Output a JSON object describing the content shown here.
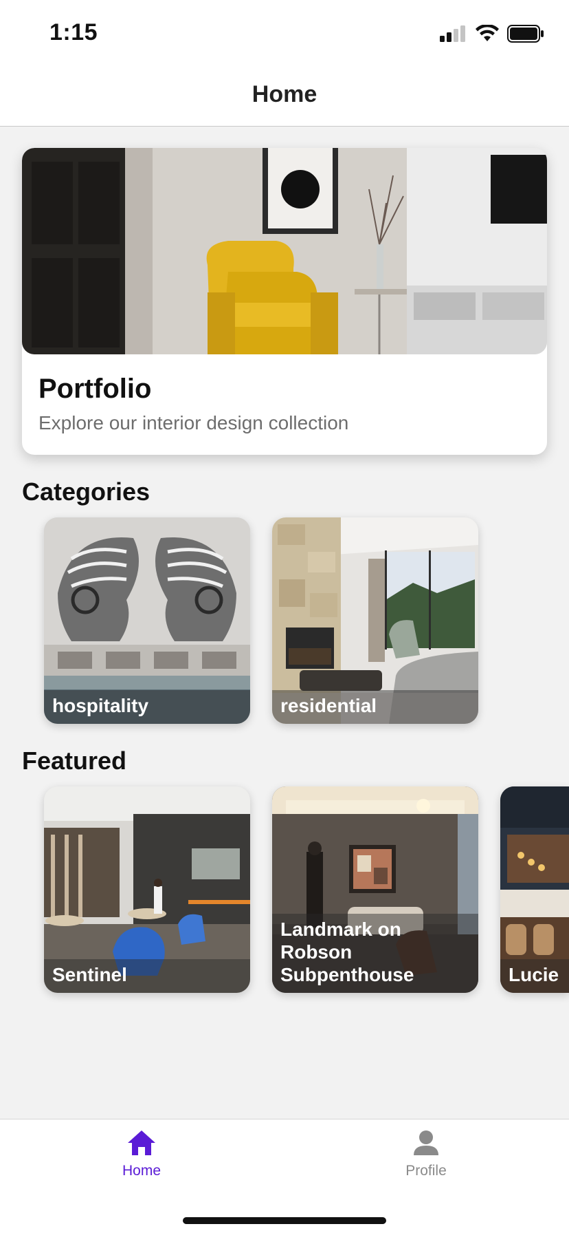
{
  "status_bar": {
    "time": "1:15"
  },
  "navbar": {
    "title": "Home"
  },
  "portfolio": {
    "title": "Portfolio",
    "subtitle": "Explore our interior design collection"
  },
  "sections": {
    "categories_title": "Categories",
    "featured_title": "Featured"
  },
  "categories": [
    {
      "label": "hospitality"
    },
    {
      "label": "residential"
    }
  ],
  "featured": [
    {
      "label": "Sentinel"
    },
    {
      "label": "Landmark on\nRobson\nSubpenthouse"
    },
    {
      "label": "Lucie"
    }
  ],
  "tabbar": {
    "items": [
      {
        "label": "Home",
        "icon": "house-icon",
        "active": true
      },
      {
        "label": "Profile",
        "icon": "person-icon",
        "active": false
      }
    ],
    "active_color": "#5a1bd6",
    "inactive_color": "#8a8a8a"
  }
}
